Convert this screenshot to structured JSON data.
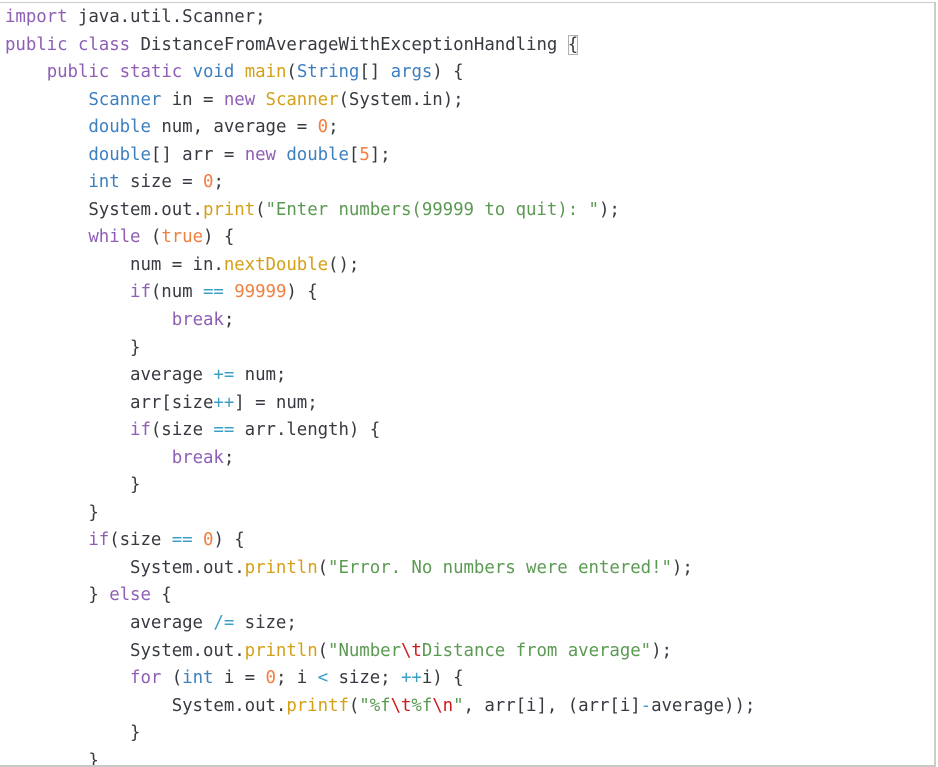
{
  "editor": {
    "language": "java",
    "matched_bracket_line": 1,
    "lines": [
      [
        [
          "kw",
          "import"
        ],
        [
          "pl",
          " java.util.Scanner;"
        ]
      ],
      [
        [
          "kw",
          "public"
        ],
        [
          "pl",
          " "
        ],
        [
          "kw",
          "class"
        ],
        [
          "pl",
          " DistanceFromAverageWithExceptionHandling "
        ],
        [
          "bm",
          "{"
        ]
      ],
      [
        [
          "pl",
          "    "
        ],
        [
          "kw",
          "public"
        ],
        [
          "pl",
          " "
        ],
        [
          "kw",
          "static"
        ],
        [
          "pl",
          " "
        ],
        [
          "ty",
          "void"
        ],
        [
          "pl",
          " "
        ],
        [
          "fn",
          "main"
        ],
        [
          "pl",
          "("
        ],
        [
          "ty",
          "String"
        ],
        [
          "pl",
          "[] "
        ],
        [
          "ty",
          "args"
        ],
        [
          "pl",
          ") {"
        ]
      ],
      [
        [
          "pl",
          "        "
        ],
        [
          "ty",
          "Scanner"
        ],
        [
          "pl",
          " in = "
        ],
        [
          "kw",
          "new"
        ],
        [
          "pl",
          " "
        ],
        [
          "fn",
          "Scanner"
        ],
        [
          "pl",
          "(System.in);"
        ]
      ],
      [
        [
          "pl",
          "        "
        ],
        [
          "ty",
          "double"
        ],
        [
          "pl",
          " num, average = "
        ],
        [
          "num",
          "0"
        ],
        [
          "pl",
          ";"
        ]
      ],
      [
        [
          "pl",
          "        "
        ],
        [
          "ty",
          "double"
        ],
        [
          "pl",
          "[] arr = "
        ],
        [
          "kw",
          "new"
        ],
        [
          "pl",
          " "
        ],
        [
          "ty",
          "double"
        ],
        [
          "pl",
          "["
        ],
        [
          "num",
          "5"
        ],
        [
          "pl",
          "];"
        ]
      ],
      [
        [
          "pl",
          "        "
        ],
        [
          "ty",
          "int"
        ],
        [
          "pl",
          " size = "
        ],
        [
          "num",
          "0"
        ],
        [
          "pl",
          ";"
        ]
      ],
      [
        [
          "pl",
          "        System.out."
        ],
        [
          "fn",
          "print"
        ],
        [
          "pl",
          "("
        ],
        [
          "str",
          "\"Enter numbers(99999 to quit): \""
        ],
        [
          "pl",
          ");"
        ]
      ],
      [
        [
          "pl",
          "        "
        ],
        [
          "kw",
          "while"
        ],
        [
          "pl",
          " ("
        ],
        [
          "num",
          "true"
        ],
        [
          "pl",
          ") {"
        ]
      ],
      [
        [
          "pl",
          "            num = in."
        ],
        [
          "fn",
          "nextDouble"
        ],
        [
          "pl",
          "();"
        ]
      ],
      [
        [
          "pl",
          "            "
        ],
        [
          "kw",
          "if"
        ],
        [
          "pl",
          "(num "
        ],
        [
          "op",
          "=="
        ],
        [
          "pl",
          " "
        ],
        [
          "num",
          "99999"
        ],
        [
          "pl",
          ") {"
        ]
      ],
      [
        [
          "pl",
          "                "
        ],
        [
          "kw",
          "break"
        ],
        [
          "pl",
          ";"
        ]
      ],
      [
        [
          "pl",
          "            }"
        ]
      ],
      [
        [
          "pl",
          "            average "
        ],
        [
          "op",
          "+="
        ],
        [
          "pl",
          " num;"
        ]
      ],
      [
        [
          "pl",
          "            arr[size"
        ],
        [
          "op",
          "++"
        ],
        [
          "pl",
          "] = num;"
        ]
      ],
      [
        [
          "pl",
          "            "
        ],
        [
          "kw",
          "if"
        ],
        [
          "pl",
          "(size "
        ],
        [
          "op",
          "=="
        ],
        [
          "pl",
          " arr.length) {"
        ]
      ],
      [
        [
          "pl",
          "                "
        ],
        [
          "kw",
          "break"
        ],
        [
          "pl",
          ";"
        ]
      ],
      [
        [
          "pl",
          "            }"
        ]
      ],
      [
        [
          "pl",
          "        }"
        ]
      ],
      [
        [
          "pl",
          "        "
        ],
        [
          "kw",
          "if"
        ],
        [
          "pl",
          "(size "
        ],
        [
          "op",
          "=="
        ],
        [
          "pl",
          " "
        ],
        [
          "num",
          "0"
        ],
        [
          "pl",
          ") {"
        ]
      ],
      [
        [
          "pl",
          "            System.out."
        ],
        [
          "fn",
          "println"
        ],
        [
          "pl",
          "("
        ],
        [
          "str",
          "\"Error. No numbers were entered!\""
        ],
        [
          "pl",
          ");"
        ]
      ],
      [
        [
          "pl",
          "        } "
        ],
        [
          "kw",
          "else"
        ],
        [
          "pl",
          " {"
        ]
      ],
      [
        [
          "pl",
          "            average "
        ],
        [
          "op",
          "/="
        ],
        [
          "pl",
          " size;"
        ]
      ],
      [
        [
          "pl",
          "            System.out."
        ],
        [
          "fn",
          "println"
        ],
        [
          "pl",
          "("
        ],
        [
          "str",
          "\"Number"
        ],
        [
          "esc",
          "\\t"
        ],
        [
          "str",
          "Distance from average\""
        ],
        [
          "pl",
          ");"
        ]
      ],
      [
        [
          "pl",
          "            "
        ],
        [
          "kw",
          "for"
        ],
        [
          "pl",
          " ("
        ],
        [
          "ty",
          "int"
        ],
        [
          "pl",
          " i = "
        ],
        [
          "num",
          "0"
        ],
        [
          "pl",
          "; i "
        ],
        [
          "op",
          "<"
        ],
        [
          "pl",
          " size; "
        ],
        [
          "op",
          "++"
        ],
        [
          "pl",
          "i) {"
        ]
      ],
      [
        [
          "pl",
          "                System.out."
        ],
        [
          "fn",
          "printf"
        ],
        [
          "pl",
          "("
        ],
        [
          "str",
          "\"%f"
        ],
        [
          "esc",
          "\\t"
        ],
        [
          "str",
          "%f"
        ],
        [
          "esc",
          "\\n"
        ],
        [
          "str",
          "\""
        ],
        [
          "pl",
          ", arr[i], (arr[i]"
        ],
        [
          "op",
          "-"
        ],
        [
          "pl",
          "average));"
        ]
      ],
      [
        [
          "pl",
          "            }"
        ]
      ],
      [
        [
          "pl",
          "        }"
        ]
      ]
    ]
  }
}
